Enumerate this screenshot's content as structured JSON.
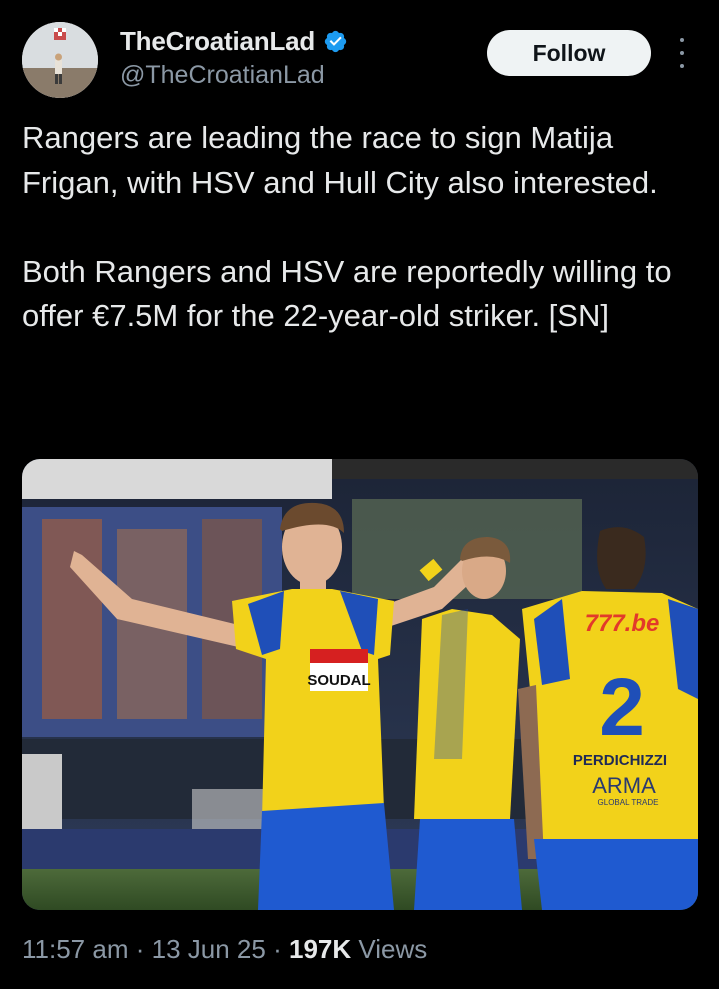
{
  "author": {
    "display_name": "TheCroatianLad",
    "handle": "@TheCroatianLad",
    "verified": true,
    "verified_icon": "verified-badge-icon",
    "accent_color": "#1d9bf0"
  },
  "actions": {
    "follow_label": "Follow",
    "more_icon": "more-vertical-icon"
  },
  "tweet": {
    "paragraphs": [
      "Rangers are leading the race to sign Matija Frigan, with HSV and Hull City also interested.",
      "Both Rangers and HSV are reportedly willing to offer €7.5M for the 22-year-old striker. [SN]"
    ]
  },
  "media": {
    "sponsor_text": "SOUDAL",
    "shirt_sponsor_right": "777.be",
    "shirt_number": "2",
    "shirt_name": "PERDICHIZZI",
    "shirt_sponsor_bottom": "ARMA",
    "shirt_sponsor_bottom_sub": "GLOBAL TRADE"
  },
  "meta": {
    "time": "11:57 am",
    "separator": "·",
    "date": "13 Jun 25",
    "views_count": "197K",
    "views_label": "Views"
  }
}
